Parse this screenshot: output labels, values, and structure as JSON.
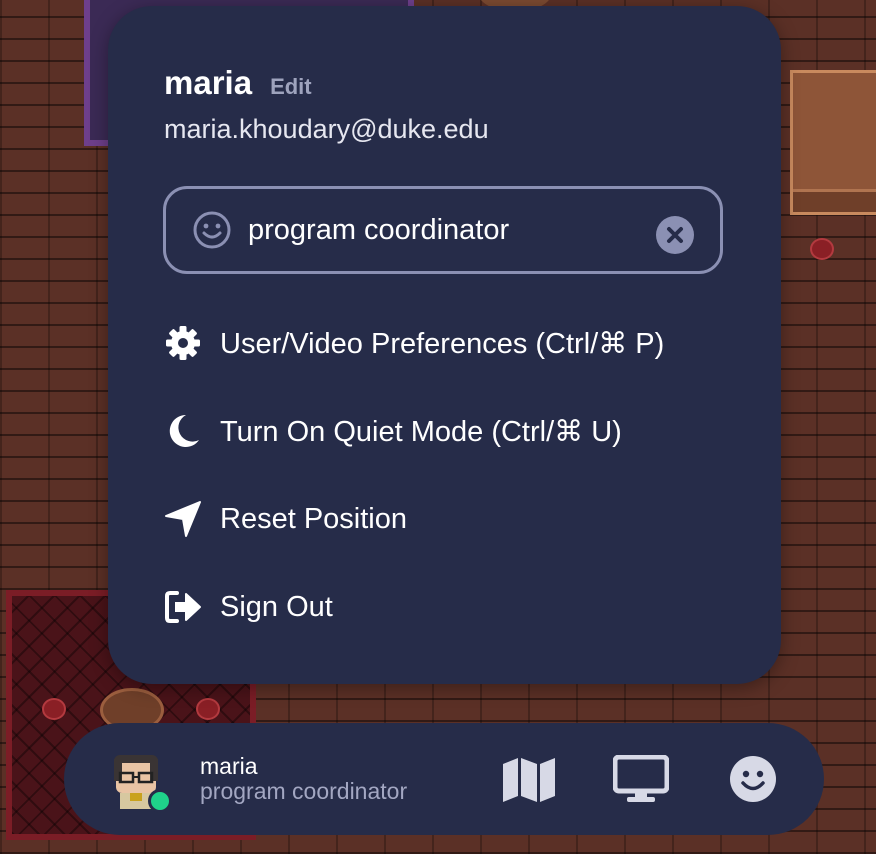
{
  "user": {
    "name": "maria",
    "edit_label": "Edit",
    "email": "maria.khoudary@duke.edu",
    "online_color": "#1fd18a"
  },
  "status_field": {
    "value": "program coordinator",
    "icon": "smile-icon",
    "clear_icon": "clear-icon"
  },
  "menu": [
    {
      "label": "User/Video Preferences (Ctrl/⌘ P)",
      "icon": "gear-icon"
    },
    {
      "label": "Turn On Quiet Mode (Ctrl/⌘ U)",
      "icon": "moon-icon"
    },
    {
      "label": "Reset Position",
      "icon": "location-arrow-icon"
    },
    {
      "label": "Sign Out",
      "icon": "sign-out-icon"
    }
  ],
  "bottom_bar": {
    "name": "maria",
    "status": "program coordinator",
    "buttons": [
      "map-icon",
      "screen-share-icon",
      "emoji-icon"
    ]
  },
  "colors": {
    "panel_bg": "#262c49",
    "muted_text": "#9ea3bd",
    "field_border": "#8b90b3"
  }
}
